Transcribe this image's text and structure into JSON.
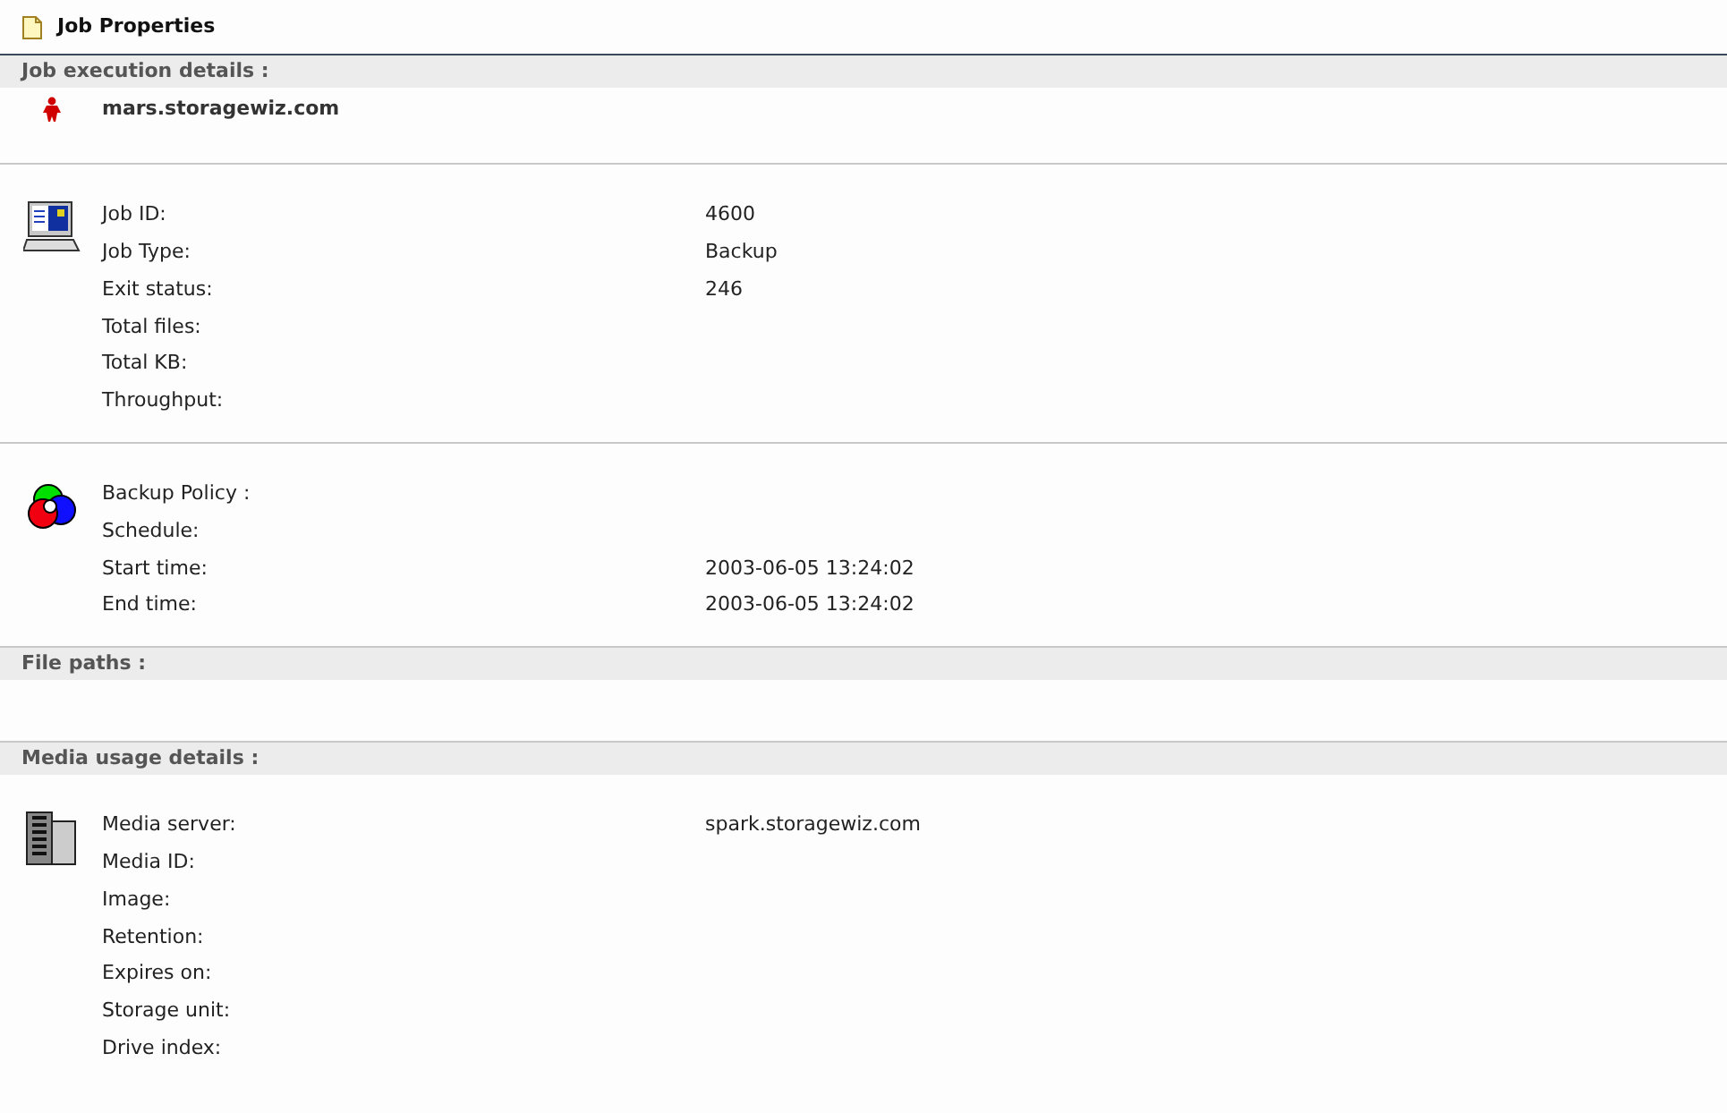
{
  "title": "Job Properties",
  "sections": [
    {
      "title": "Job execution details :",
      "groups": [
        {
          "kind": "host",
          "host": "mars.storagewiz.com"
        },
        {
          "kind": "fields",
          "rows": [
            {
              "label": "Job ID:",
              "value": "4600"
            },
            {
              "label": "Job Type:",
              "value": "Backup"
            },
            {
              "label": "Exit status:",
              "value": "246"
            },
            {
              "label": "Total files:"
            },
            {
              "label": "Total KB:"
            },
            {
              "label": "Throughput:"
            }
          ]
        },
        {
          "kind": "fields",
          "rows": [
            {
              "label": "Backup Policy :"
            },
            {
              "label": "Schedule:"
            },
            {
              "label": "Start time:",
              "value": "2003-06-05 13:24:02"
            },
            {
              "label": "End time:",
              "value": "2003-06-05 13:24:02"
            }
          ]
        }
      ]
    },
    {
      "title": "File paths :"
    },
    {
      "title": "Media usage details :",
      "groups": [
        {
          "kind": "fields",
          "rows": [
            {
              "label": "Media server:",
              "value": "spark.storagewiz.com"
            },
            {
              "label": "Media ID:"
            },
            {
              "label": "Image:"
            },
            {
              "label": "Retention:"
            },
            {
              "label": "Expires on:"
            },
            {
              "label": "Storage unit:"
            },
            {
              "label": "Drive index:"
            }
          ]
        }
      ]
    }
  ]
}
